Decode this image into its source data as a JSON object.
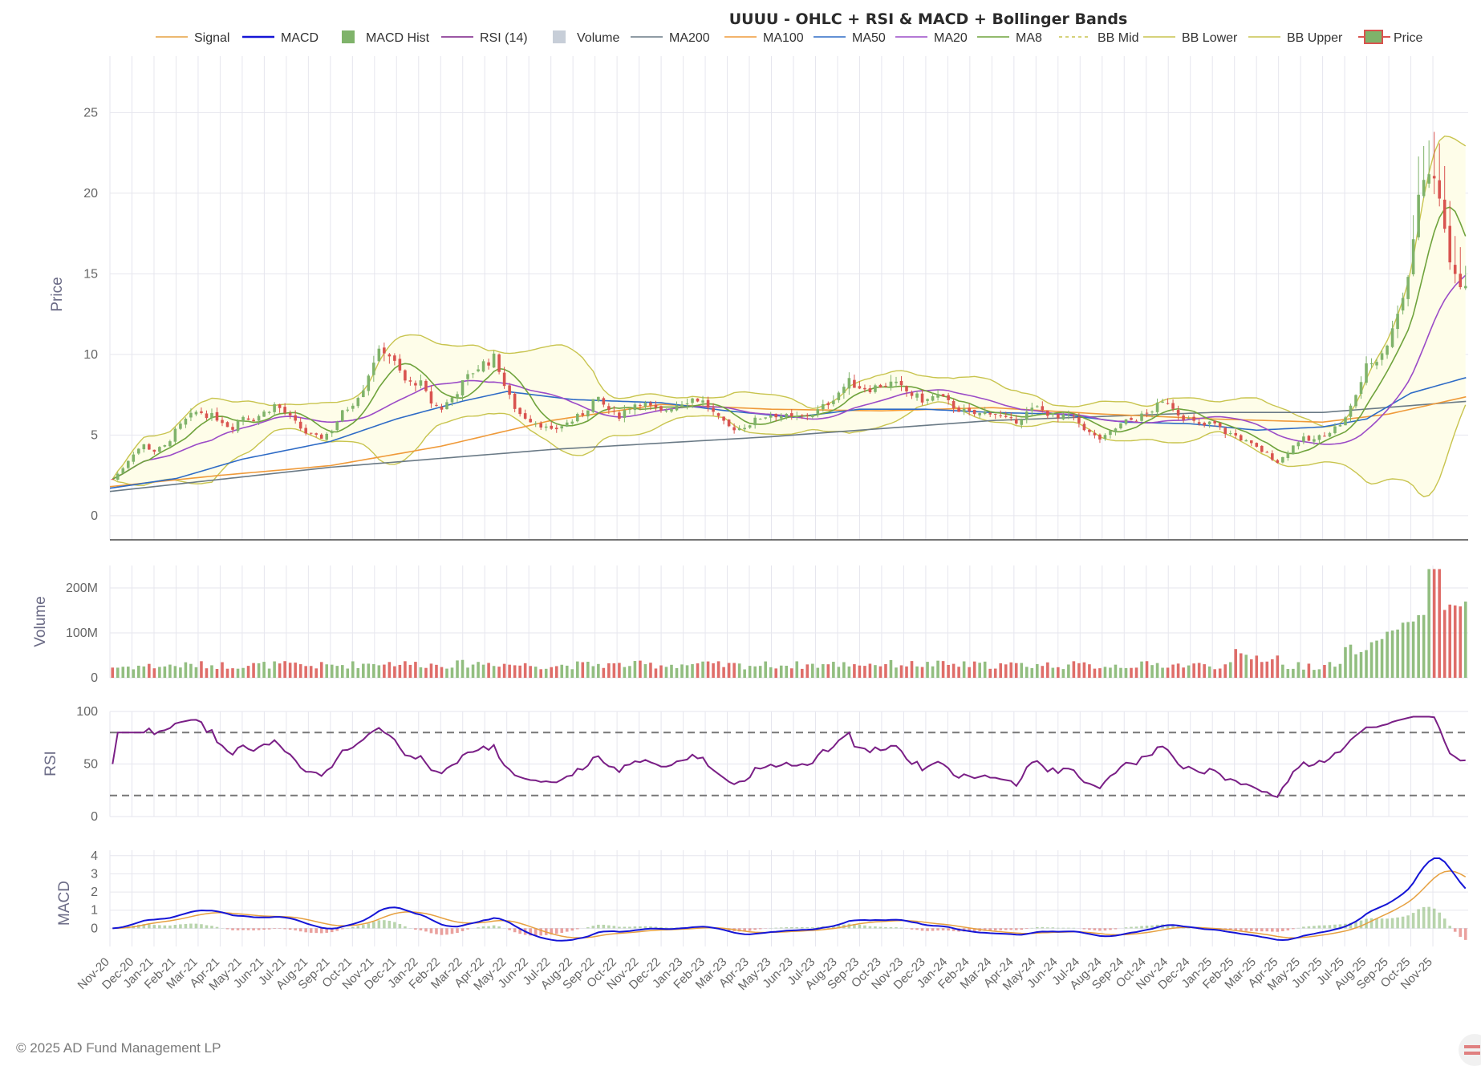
{
  "colors": {
    "up": "#7fb36a",
    "down": "#d9534f",
    "signal": "#e6a040",
    "macd": "#1515d6",
    "rsi": "#7a1f86",
    "volume_legend": "#c7ced8",
    "ma200": "#6a7a86",
    "ma100": "#ef9a3a",
    "ma50": "#2e6bc6",
    "ma20": "#9b4bc7",
    "ma8": "#6fa33c",
    "bb": "#c8c44e",
    "bb_fill": "#fefde9",
    "grid": "#e6e6ee",
    "ref_line": "#777777"
  },
  "footer": "© 2025 AD Fund Management LP",
  "chart_data": {
    "type": "line",
    "title": "UUUU - OHLC + RSI & MACD + Bollinger Bands",
    "legend": [
      "Signal",
      "MACD",
      "MACD Hist",
      "RSI (14)",
      "Volume",
      "MA200",
      "MA100",
      "MA50",
      "MA20",
      "MA8",
      "BB Mid",
      "BB Lower",
      "BB Upper",
      "Price"
    ],
    "legend_placement": "top",
    "grid": true,
    "x_axis": {
      "ticks": [
        "Nov-20",
        "Dec-20",
        "Jan-21",
        "Feb-21",
        "Mar-21",
        "Apr-21",
        "May-21",
        "Jun-21",
        "Jul-21",
        "Aug-21",
        "Sep-21",
        "Oct-21",
        "Nov-21",
        "Dec-21",
        "Jan-22",
        "Feb-22",
        "Mar-22",
        "Apr-22",
        "May-22",
        "Jun-22",
        "Jul-22",
        "Aug-22",
        "Sep-22",
        "Oct-22",
        "Nov-22",
        "Dec-22",
        "Jan-23",
        "Feb-23",
        "Mar-23",
        "Apr-23",
        "May-23",
        "Jun-23",
        "Jul-23",
        "Aug-23",
        "Sep-23",
        "Oct-23",
        "Nov-23",
        "Dec-23",
        "Jan-24",
        "Feb-24",
        "Mar-24",
        "Apr-24",
        "May-24",
        "Jun-24",
        "Jul-24",
        "Aug-24",
        "Sep-24",
        "Oct-24",
        "Nov-24",
        "Dec-24",
        "Jan-25",
        "Feb-25",
        "Mar-25",
        "Apr-25",
        "May-25",
        "Jun-25",
        "Jul-25",
        "Aug-25",
        "Sep-25",
        "Oct-25",
        "Nov-25"
      ],
      "range_months": [
        0,
        61.6
      ]
    },
    "price_panel": {
      "ylabel": "Price",
      "ylim": [
        -1.5,
        28.5
      ],
      "yticks": [
        0,
        5,
        10,
        15,
        20,
        25
      ],
      "close_knots": [
        [
          0,
          2.1
        ],
        [
          0.5,
          2.8
        ],
        [
          1,
          3.8
        ],
        [
          1.5,
          4.4
        ],
        [
          2,
          4.0
        ],
        [
          2.5,
          4.3
        ],
        [
          3,
          5.3
        ],
        [
          3.5,
          6.0
        ],
        [
          4,
          6.5
        ],
        [
          4.5,
          6.2
        ],
        [
          5,
          6.0
        ],
        [
          5.5,
          5.4
        ],
        [
          6,
          6.2
        ],
        [
          6.5,
          6.0
        ],
        [
          7,
          6.4
        ],
        [
          7.5,
          6.9
        ],
        [
          8,
          6.3
        ],
        [
          8.5,
          5.6
        ],
        [
          9,
          5.0
        ],
        [
          9.5,
          4.8
        ],
        [
          10,
          5.2
        ],
        [
          10.5,
          6.3
        ],
        [
          11,
          7.0
        ],
        [
          11.5,
          8.0
        ],
        [
          12,
          9.8
        ],
        [
          12.5,
          10.4
        ],
        [
          13,
          9.2
        ],
        [
          13.5,
          8.1
        ],
        [
          14,
          8.4
        ],
        [
          14.5,
          7.1
        ],
        [
          15,
          6.6
        ],
        [
          15.5,
          7.3
        ],
        [
          16,
          8.2
        ],
        [
          16.5,
          9.0
        ],
        [
          17,
          9.5
        ],
        [
          17.5,
          9.8
        ],
        [
          18,
          7.6
        ],
        [
          18.5,
          6.4
        ],
        [
          19,
          6.0
        ],
        [
          19.5,
          5.7
        ],
        [
          20,
          5.2
        ],
        [
          20.5,
          5.6
        ],
        [
          21,
          5.9
        ],
        [
          21.5,
          6.4
        ],
        [
          22,
          7.3
        ],
        [
          22.5,
          6.7
        ],
        [
          23,
          6.1
        ],
        [
          23.5,
          6.7
        ],
        [
          24,
          7.1
        ],
        [
          24.5,
          6.7
        ],
        [
          25,
          6.4
        ],
        [
          25.5,
          6.8
        ],
        [
          26,
          7.1
        ],
        [
          26.5,
          7.3
        ],
        [
          27,
          7.0
        ],
        [
          27.5,
          6.1
        ],
        [
          28,
          5.5
        ],
        [
          28.5,
          5.4
        ],
        [
          29,
          5.7
        ],
        [
          29.5,
          6.1
        ],
        [
          30,
          6.3
        ],
        [
          30.5,
          6.2
        ],
        [
          31,
          6.0
        ],
        [
          31.5,
          6.2
        ],
        [
          32,
          6.4
        ],
        [
          32.5,
          6.9
        ],
        [
          33,
          7.6
        ],
        [
          33.5,
          8.3
        ],
        [
          34,
          8.0
        ],
        [
          34.5,
          7.9
        ],
        [
          35,
          8.1
        ],
        [
          35.5,
          8.2
        ],
        [
          36,
          7.8
        ],
        [
          36.5,
          7.4
        ],
        [
          37,
          7.1
        ],
        [
          37.5,
          7.5
        ],
        [
          38,
          7.0
        ],
        [
          38.5,
          6.6
        ],
        [
          39,
          6.3
        ],
        [
          39.5,
          6.3
        ],
        [
          40,
          6.5
        ],
        [
          40.5,
          6.0
        ],
        [
          41,
          5.8
        ],
        [
          41.5,
          6.3
        ],
        [
          42,
          6.7
        ],
        [
          42.5,
          6.4
        ],
        [
          43,
          6.0
        ],
        [
          43.5,
          6.2
        ],
        [
          44,
          5.7
        ],
        [
          44.5,
          5.0
        ],
        [
          45,
          4.7
        ],
        [
          45.5,
          5.3
        ],
        [
          46,
          5.8
        ],
        [
          46.5,
          6.0
        ],
        [
          47,
          6.3
        ],
        [
          47.5,
          6.8
        ],
        [
          48,
          7.1
        ],
        [
          48.5,
          6.3
        ],
        [
          49,
          5.9
        ],
        [
          49.5,
          5.5
        ],
        [
          50,
          5.8
        ],
        [
          50.5,
          5.2
        ],
        [
          51,
          5.0
        ],
        [
          51.5,
          4.6
        ],
        [
          52,
          4.2
        ],
        [
          52.5,
          3.8
        ],
        [
          53,
          3.3
        ],
        [
          53.5,
          4.1
        ],
        [
          54,
          4.8
        ],
        [
          54.5,
          4.6
        ],
        [
          55,
          5.0
        ],
        [
          55.5,
          5.4
        ],
        [
          56,
          5.9
        ],
        [
          56.5,
          7.5
        ],
        [
          57,
          9.2
        ],
        [
          57.5,
          9.9
        ],
        [
          58,
          10.8
        ],
        [
          58.5,
          13.0
        ],
        [
          59,
          16.0
        ],
        [
          59.5,
          20.8
        ],
        [
          60,
          21.2
        ],
        [
          60.5,
          18.0
        ],
        [
          61,
          14.5
        ],
        [
          61.6,
          14.0
        ]
      ],
      "ma200_knots": [
        [
          0,
          1.5
        ],
        [
          10,
          3.0
        ],
        [
          20,
          4.1
        ],
        [
          30,
          4.9
        ],
        [
          40,
          5.9
        ],
        [
          50,
          6.4
        ],
        [
          55,
          6.4
        ],
        [
          61.6,
          7.1
        ]
      ],
      "ma100_knots": [
        [
          0,
          1.8
        ],
        [
          5,
          2.5
        ],
        [
          10,
          3.1
        ],
        [
          15,
          4.3
        ],
        [
          20,
          5.9
        ],
        [
          25,
          6.9
        ],
        [
          30,
          6.6
        ],
        [
          35,
          6.5
        ],
        [
          40,
          6.7
        ],
        [
          45,
          6.3
        ],
        [
          50,
          6.0
        ],
        [
          55,
          5.8
        ],
        [
          58,
          6.3
        ],
        [
          61.6,
          7.4
        ]
      ],
      "ma50_knots": [
        [
          0,
          1.7
        ],
        [
          3,
          2.3
        ],
        [
          6,
          3.5
        ],
        [
          10,
          4.6
        ],
        [
          13,
          6.0
        ],
        [
          16,
          7.1
        ],
        [
          18,
          7.7
        ],
        [
          21,
          7.2
        ],
        [
          25,
          7.0
        ],
        [
          28,
          6.5
        ],
        [
          31,
          6.1
        ],
        [
          34,
          6.6
        ],
        [
          37,
          6.6
        ],
        [
          40,
          6.4
        ],
        [
          43,
          6.3
        ],
        [
          46,
          5.8
        ],
        [
          49,
          5.7
        ],
        [
          52,
          5.3
        ],
        [
          55,
          5.5
        ],
        [
          57,
          6.0
        ],
        [
          59,
          7.6
        ],
        [
          61.6,
          8.6
        ]
      ]
    },
    "volume_panel": {
      "ylabel": "Volume",
      "ylim": [
        0,
        250000000
      ],
      "yticks": [
        0,
        100000000,
        200000000
      ],
      "ytick_labels": [
        "0",
        "100M",
        "200M"
      ]
    },
    "rsi_panel": {
      "ylabel": "RSI",
      "ylim": [
        0,
        100
      ],
      "yticks": [
        0,
        50,
        100
      ],
      "ref_levels": [
        80,
        20
      ]
    },
    "macd_panel": {
      "ylabel": "MACD",
      "ylim": [
        -1.0,
        4.3
      ],
      "yticks": [
        0,
        1,
        2,
        3,
        4
      ]
    }
  }
}
